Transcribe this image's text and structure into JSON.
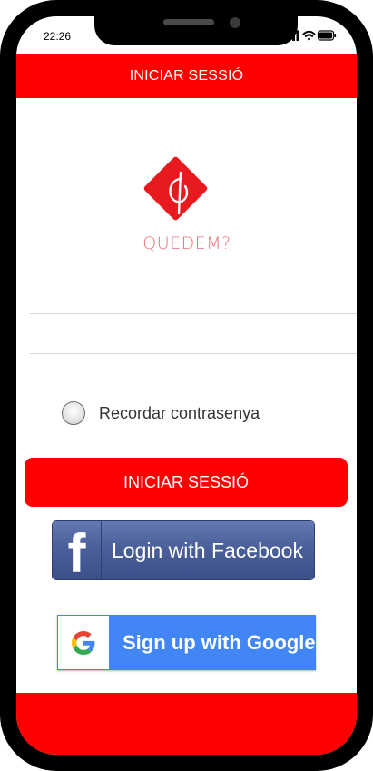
{
  "status_bar": {
    "time": "22:26"
  },
  "header": {
    "title": "INICIAR SESSIÓ"
  },
  "logo": {
    "text": "QUEDEM?"
  },
  "form": {
    "username": {
      "value": "",
      "placeholder": ""
    },
    "password": {
      "value": "",
      "placeholder": ""
    },
    "remember_label": "Recordar contrasenya",
    "remember_checked": false
  },
  "buttons": {
    "login_label": "INICIAR SESSIÓ",
    "facebook_label": "Login with Facebook",
    "google_label": "Sign up with Google"
  },
  "icons": {
    "signal": "signal-icon",
    "wifi": "wifi-icon",
    "battery": "battery-icon",
    "app_logo": "quedem-logo-icon",
    "facebook": "facebook-f-icon",
    "google": "google-g-icon"
  },
  "colors": {
    "brand_red": "#ff0000",
    "logo_red": "#e8191f",
    "facebook_blue": "#4b5f9a",
    "google_blue": "#4285f4"
  }
}
